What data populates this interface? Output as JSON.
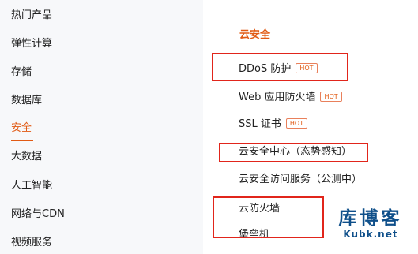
{
  "sidebar": {
    "items": [
      {
        "label": "热门产品"
      },
      {
        "label": "弹性计算"
      },
      {
        "label": "存储"
      },
      {
        "label": "数据库"
      },
      {
        "label": "安全"
      },
      {
        "label": "大数据"
      },
      {
        "label": "人工智能"
      },
      {
        "label": "网络与CDN"
      },
      {
        "label": "视频服务"
      }
    ],
    "active": "安全"
  },
  "main": {
    "section_title": "云安全",
    "products": [
      {
        "label": "DDoS 防护",
        "badge": "HOT"
      },
      {
        "label": "Web 应用防火墙",
        "badge": "HOT"
      },
      {
        "label": "SSL 证书",
        "badge": "HOT"
      },
      {
        "label": "云安全中心（态势感知）"
      },
      {
        "label": "云安全访问服务（公测中）"
      },
      {
        "label": "云防火墙"
      },
      {
        "label": "堡垒机"
      }
    ]
  },
  "watermark": {
    "title": "库博客",
    "url": "Kubk.net"
  },
  "colors": {
    "accent": "#e15a14",
    "highlight_box": "#e1251b",
    "watermark": "#0e4f8a",
    "sidebar_bg": "#f7f8fa"
  }
}
